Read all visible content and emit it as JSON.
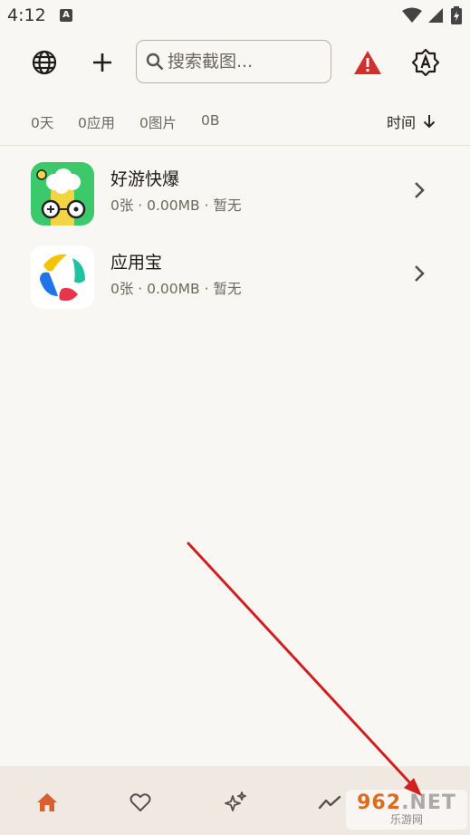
{
  "status_bar": {
    "time": "4:12",
    "notification_icon": "A"
  },
  "toolbar": {
    "search_placeholder": "搜索截图...",
    "icons": [
      "globe-icon",
      "plus-icon",
      "search-icon",
      "warning-icon",
      "auto-brightness-icon"
    ]
  },
  "stats": {
    "days": "0天",
    "apps": "0应用",
    "images": "0图片",
    "size": "0B",
    "sort_label": "时间"
  },
  "apps": [
    {
      "name": "好游快爆",
      "meta": "0张 · 0.00MB · 暂无"
    },
    {
      "name": "应用宝",
      "meta": "0张 · 0.00MB · 暂无"
    }
  ],
  "bottom_nav": [
    "home-icon",
    "heart-icon",
    "sparkle-icon",
    "trend-icon"
  ],
  "watermark": {
    "main_digits": "962",
    "main_suffix": ".NET",
    "sub": "乐游网"
  },
  "colors": {
    "accent": "#d9602e",
    "warning": "#d32f2f",
    "arrow": "#d11f1f"
  }
}
